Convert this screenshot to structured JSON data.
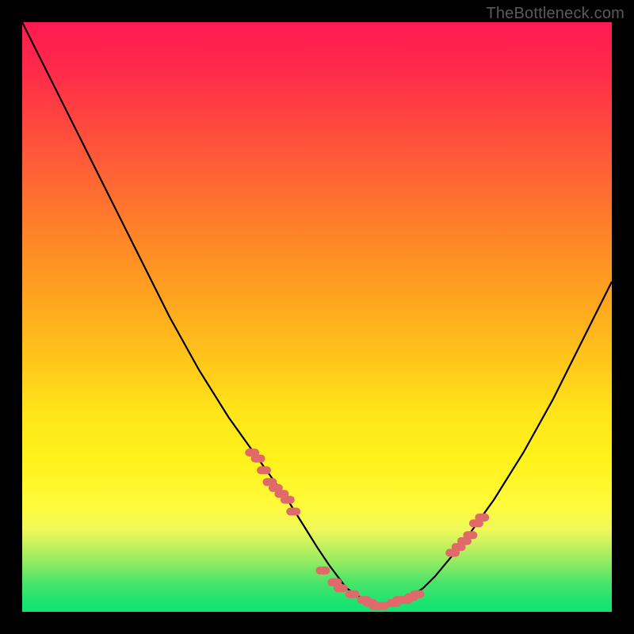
{
  "watermark": "TheBottleneck.com",
  "colors": {
    "background": "#000000",
    "curve_stroke": "#000000",
    "marker_fill": "#e06a6a",
    "marker_stroke": "#e06a6a"
  },
  "chart_data": {
    "type": "line",
    "title": "",
    "xlabel": "",
    "ylabel": "",
    "xlim": [
      0,
      100
    ],
    "ylim": [
      0,
      100
    ],
    "grid": false,
    "legend": false,
    "annotations": [],
    "series": [
      {
        "name": "bottleneck-curve",
        "x": [
          0,
          5,
          10,
          15,
          20,
          25,
          30,
          35,
          40,
          45,
          50,
          52,
          55,
          58,
          60,
          62,
          65,
          68,
          70,
          75,
          80,
          85,
          90,
          95,
          100
        ],
        "values": [
          100,
          90,
          80,
          70,
          60,
          50,
          41,
          33,
          26,
          19,
          11,
          8,
          4,
          2,
          1,
          1,
          2,
          4,
          6,
          12,
          19,
          27,
          36,
          46,
          56
        ]
      },
      {
        "name": "markers-left-slope",
        "x": [
          39,
          40,
          41,
          42,
          43,
          44,
          45,
          46
        ],
        "values": [
          27,
          26,
          24,
          22,
          21,
          20,
          19,
          17
        ]
      },
      {
        "name": "markers-bottom",
        "x": [
          51,
          53,
          54,
          56,
          58,
          59,
          60,
          61,
          63,
          64,
          65,
          66,
          67
        ],
        "values": [
          7,
          5,
          4,
          3,
          2,
          1.5,
          1,
          1,
          1.5,
          2,
          2,
          2.5,
          3
        ]
      },
      {
        "name": "markers-right-slope",
        "x": [
          73,
          74,
          75,
          76,
          77,
          78
        ],
        "values": [
          10,
          11,
          12,
          13,
          15,
          16
        ]
      }
    ]
  }
}
